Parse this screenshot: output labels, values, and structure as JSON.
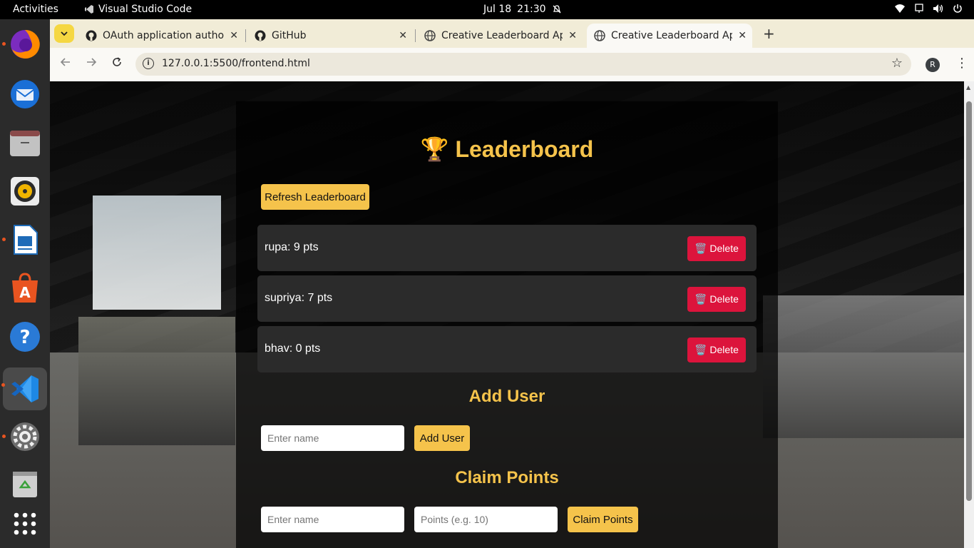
{
  "topbar": {
    "activities": "Activities",
    "app_name": "Visual Studio Code",
    "date": "Jul 18",
    "time": "21:30"
  },
  "dock": {
    "items": [
      "Firefox",
      "Thunderbird",
      "Files",
      "Rhythmbox",
      "LibreOffice Writer",
      "Ubuntu Software",
      "Help",
      "Visual Studio Code",
      "Settings",
      "Trash",
      "Show Applications"
    ]
  },
  "browser": {
    "tabs": [
      {
        "title": "OAuth application autho",
        "icon": "github-icon"
      },
      {
        "title": "GitHub",
        "icon": "github-icon"
      },
      {
        "title": "Creative Leaderboard Ap",
        "icon": "globe-icon"
      },
      {
        "title": "Creative Leaderboard Ap",
        "icon": "globe-icon",
        "active": true
      }
    ],
    "url": "127.0.0.1:5500/frontend.html",
    "profile_initial": "R"
  },
  "page": {
    "title": "🏆 Leaderboard",
    "refresh_label": "Refresh Leaderboard",
    "entries": [
      {
        "label": "rupa: 9 pts"
      },
      {
        "label": "supriya: 7 pts"
      },
      {
        "label": "bhav: 0 pts"
      }
    ],
    "delete_label": "🗑️ Delete",
    "add_user": {
      "heading": "Add User",
      "name_placeholder": "Enter name",
      "button": "Add User"
    },
    "claim": {
      "heading": "Claim Points",
      "name_placeholder": "Enter name",
      "points_placeholder": "Points (e.g. 10)",
      "button": "Claim Points"
    }
  },
  "colors": {
    "accent": "#f5c34b",
    "danger": "#dc143c",
    "row_bg": "#2b2b2b"
  }
}
